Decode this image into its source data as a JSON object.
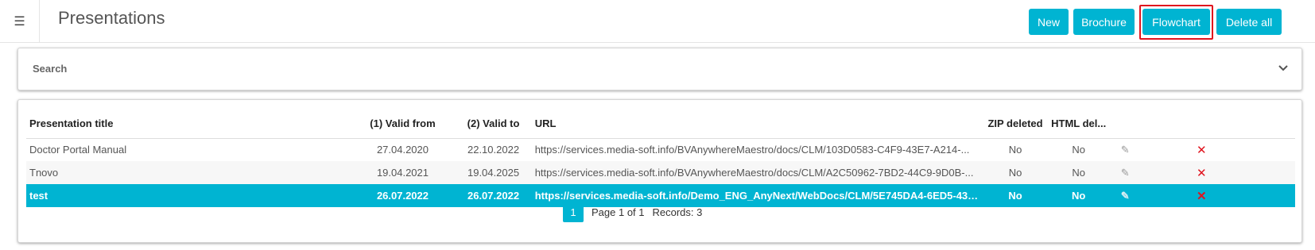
{
  "header": {
    "menu_icon": "hamburger-menu-icon",
    "title": "Presentations",
    "buttons": {
      "new": "New",
      "brochure": "Brochure",
      "flowchart": "Flowchart",
      "delete_all": "Delete all"
    },
    "highlight_color": "#e0141e",
    "accent_color": "#00b4d2"
  },
  "search": {
    "label": "Search",
    "toggle_icon": "chevron-down-icon"
  },
  "table": {
    "columns": [
      "Presentation title",
      "(1) Valid from",
      "(2) Valid to",
      "URL",
      "ZIP deleted",
      "HTML del...",
      "",
      ""
    ],
    "rows": [
      {
        "title": "Doctor Portal Manual",
        "valid_from": "27.04.2020",
        "valid_to": "22.10.2022",
        "url": "https://services.media-soft.info/BVAnywhereMaestro/docs/CLM/103D0583-C4F9-43E7-A214-...",
        "zip_deleted": "No",
        "html_deleted": "No",
        "edit_icon": "edit-icon",
        "delete_icon": "delete-x-icon",
        "selected": false
      },
      {
        "title": "Tnovo",
        "valid_from": "19.04.2021",
        "valid_to": "19.04.2025",
        "url": "https://services.media-soft.info/BVAnywhereMaestro/docs/CLM/A2C50962-7BD2-44C9-9D0B-...",
        "zip_deleted": "No",
        "html_deleted": "No",
        "edit_icon": "edit-icon",
        "delete_icon": "delete-x-icon",
        "selected": false
      },
      {
        "title": "test",
        "valid_from": "26.07.2022",
        "valid_to": "26.07.2022",
        "url": "https://services.media-soft.info/Demo_ENG_AnyNext/WebDocs/CLM/5E745DA4-6ED5-433A-...",
        "zip_deleted": "No",
        "html_deleted": "No",
        "edit_icon": "edit-icon",
        "delete_icon": "delete-x-icon",
        "selected": true
      }
    ]
  },
  "pager": {
    "current_page": "1",
    "page_text": "Page 1 of 1",
    "records_text": "Records: 3"
  }
}
